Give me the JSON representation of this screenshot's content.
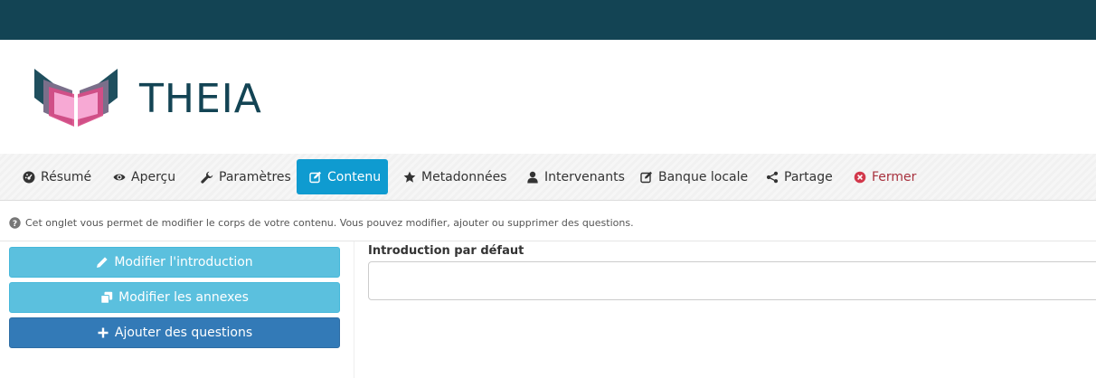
{
  "app": {
    "brand_title": "THEIA"
  },
  "tabs": [
    {
      "label": "Résumé",
      "icon": "dashboard-icon"
    },
    {
      "label": "Aperçu",
      "icon": "eye-icon"
    },
    {
      "label": "Paramètres",
      "icon": "wrench-icon"
    },
    {
      "label": "Contenu",
      "icon": "edit-icon",
      "active": true
    },
    {
      "label": "Metadonnées",
      "icon": "star-icon"
    },
    {
      "label": "Intervenants",
      "icon": "user-icon"
    },
    {
      "label": "Banque locale",
      "icon": "edit-icon"
    },
    {
      "label": "Partage",
      "icon": "share-icon"
    },
    {
      "label": "Fermer",
      "icon": "close-circle-icon"
    }
  ],
  "help": {
    "text": "Cet onglet vous permet de modifier le corps de votre contenu. Vous pouvez modifier, ajouter ou supprimer des questions."
  },
  "actions": {
    "edit_intro": "Modifier l'introduction",
    "edit_annexes": "Modifier les annexes",
    "add_questions": "Ajouter des questions"
  },
  "intro": {
    "label": "Introduction par défaut",
    "value": ""
  },
  "colors": {
    "topbar": "#134454",
    "brand": "#134454",
    "active_tab": "#0f9bd0",
    "info_button": "#5bc0de",
    "primary_button": "#337ab7",
    "danger_text": "#a8323e"
  }
}
